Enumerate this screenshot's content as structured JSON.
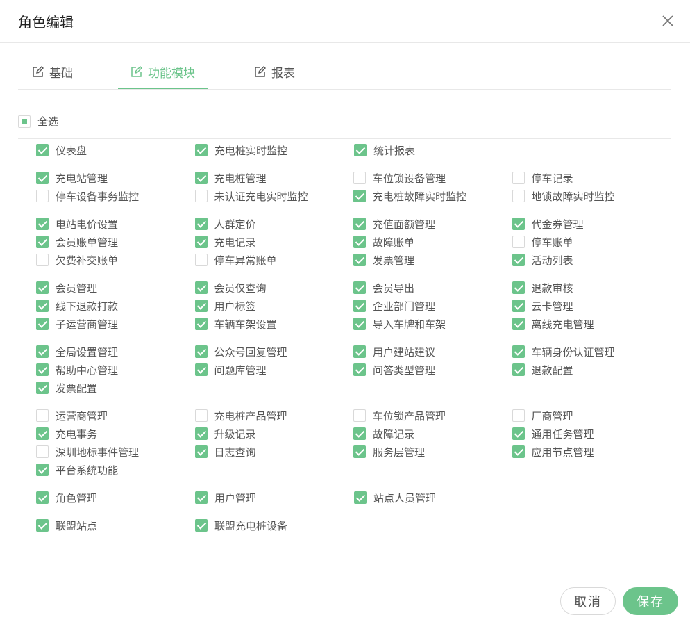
{
  "dialog": {
    "title": "角色编辑"
  },
  "tabs": [
    {
      "label": "基础",
      "active": false
    },
    {
      "label": "功能模块",
      "active": true
    },
    {
      "label": "报表",
      "active": false
    }
  ],
  "select_all": {
    "label": "全选",
    "state": "indeterminate"
  },
  "groups": [
    {
      "rows": [
        [
          {
            "label": "仪表盘",
            "checked": true
          },
          {
            "label": "充电桩实时监控",
            "checked": true
          },
          {
            "label": "统计报表",
            "checked": true
          }
        ]
      ]
    },
    {
      "rows": [
        [
          {
            "label": "充电站管理",
            "checked": true
          },
          {
            "label": "充电桩管理",
            "checked": true
          },
          {
            "label": "车位锁设备管理",
            "checked": false
          },
          {
            "label": "停车记录",
            "checked": false
          }
        ],
        [
          {
            "label": "停车设备事务监控",
            "checked": false
          },
          {
            "label": "未认证充电实时监控",
            "checked": false
          },
          {
            "label": "充电桩故障实时监控",
            "checked": true
          },
          {
            "label": "地锁故障实时监控",
            "checked": false
          }
        ]
      ]
    },
    {
      "rows": [
        [
          {
            "label": "电站电价设置",
            "checked": true
          },
          {
            "label": "人群定价",
            "checked": true
          },
          {
            "label": "充值面额管理",
            "checked": true
          },
          {
            "label": "代金券管理",
            "checked": true
          }
        ],
        [
          {
            "label": "会员账单管理",
            "checked": true
          },
          {
            "label": "充电记录",
            "checked": true
          },
          {
            "label": "故障账单",
            "checked": true
          },
          {
            "label": "停车账单",
            "checked": false
          }
        ],
        [
          {
            "label": "欠费补交账单",
            "checked": false
          },
          {
            "label": "停车异常账单",
            "checked": false
          },
          {
            "label": "发票管理",
            "checked": true
          },
          {
            "label": "活动列表",
            "checked": true
          }
        ]
      ]
    },
    {
      "rows": [
        [
          {
            "label": "会员管理",
            "checked": true
          },
          {
            "label": "会员仅查询",
            "checked": true
          },
          {
            "label": "会员导出",
            "checked": true
          },
          {
            "label": "退款审核",
            "checked": true
          }
        ],
        [
          {
            "label": "线下退款打款",
            "checked": true
          },
          {
            "label": "用户标签",
            "checked": true
          },
          {
            "label": "企业部门管理",
            "checked": true
          },
          {
            "label": "云卡管理",
            "checked": true
          }
        ],
        [
          {
            "label": "子运营商管理",
            "checked": true
          },
          {
            "label": "车辆车架设置",
            "checked": true
          },
          {
            "label": "导入车牌和车架",
            "checked": true
          },
          {
            "label": "离线充电管理",
            "checked": true
          }
        ]
      ]
    },
    {
      "rows": [
        [
          {
            "label": "全局设置管理",
            "checked": true
          },
          {
            "label": "公众号回复管理",
            "checked": true
          },
          {
            "label": "用户建站建议",
            "checked": true
          },
          {
            "label": "车辆身份认证管理",
            "checked": true
          }
        ],
        [
          {
            "label": "帮助中心管理",
            "checked": true
          },
          {
            "label": "问题库管理",
            "checked": true
          },
          {
            "label": "问答类型管理",
            "checked": true
          },
          {
            "label": "退款配置",
            "checked": true
          }
        ],
        [
          {
            "label": "发票配置",
            "checked": true
          }
        ]
      ]
    },
    {
      "rows": [
        [
          {
            "label": "运营商管理",
            "checked": false
          },
          {
            "label": "充电桩产品管理",
            "checked": false
          },
          {
            "label": "车位锁产品管理",
            "checked": false
          },
          {
            "label": "厂商管理",
            "checked": false
          }
        ],
        [
          {
            "label": "充电事务",
            "checked": true
          },
          {
            "label": "升级记录",
            "checked": true
          },
          {
            "label": "故障记录",
            "checked": true
          },
          {
            "label": "通用任务管理",
            "checked": true
          }
        ],
        [
          {
            "label": "深圳地标事件管理",
            "checked": false
          },
          {
            "label": "日志查询",
            "checked": true
          },
          {
            "label": "服务层管理",
            "checked": true
          },
          {
            "label": "应用节点管理",
            "checked": true
          }
        ],
        [
          {
            "label": "平台系统功能",
            "checked": true
          }
        ]
      ]
    },
    {
      "rows": [
        [
          {
            "label": "角色管理",
            "checked": true
          },
          {
            "label": "用户管理",
            "checked": true
          },
          {
            "label": "站点人员管理",
            "checked": true
          }
        ]
      ]
    },
    {
      "rows": [
        [
          {
            "label": "联盟站点",
            "checked": true
          },
          {
            "label": "联盟充电桩设备",
            "checked": true
          }
        ]
      ]
    }
  ],
  "footer": {
    "cancel_label": "取消",
    "save_label": "保存"
  },
  "colors": {
    "accent": "#6cc48b",
    "border": "#d9d9d9",
    "text": "#555555"
  },
  "icons": {
    "close": "close-icon",
    "tab": "edit-icon"
  }
}
